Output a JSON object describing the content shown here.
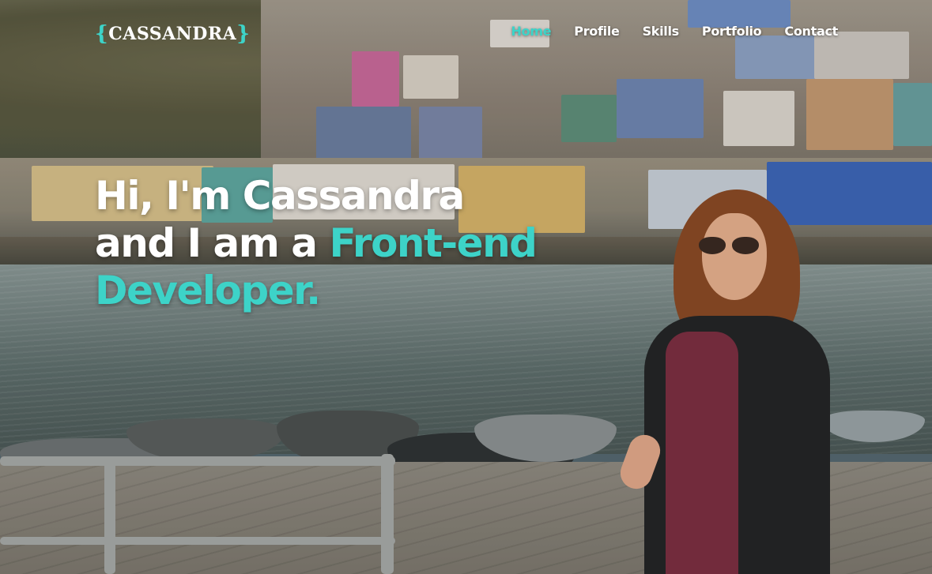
{
  "brand": {
    "open_brace": "{",
    "name": "CASSANDRA",
    "close_brace": "}"
  },
  "nav": {
    "items": [
      {
        "label": "Home",
        "active": true
      },
      {
        "label": "Profile",
        "active": false
      },
      {
        "label": "Skills",
        "active": false
      },
      {
        "label": "Portfolio",
        "active": false
      },
      {
        "label": "Contact",
        "active": false
      }
    ]
  },
  "hero": {
    "line1": "Hi, I'm Cassandra",
    "line2_prefix": "and I am a ",
    "line2_accent": "Front-end",
    "line3_accent": "Developer."
  },
  "colors": {
    "accent": "#3dd3c8",
    "text": "#ffffff"
  }
}
